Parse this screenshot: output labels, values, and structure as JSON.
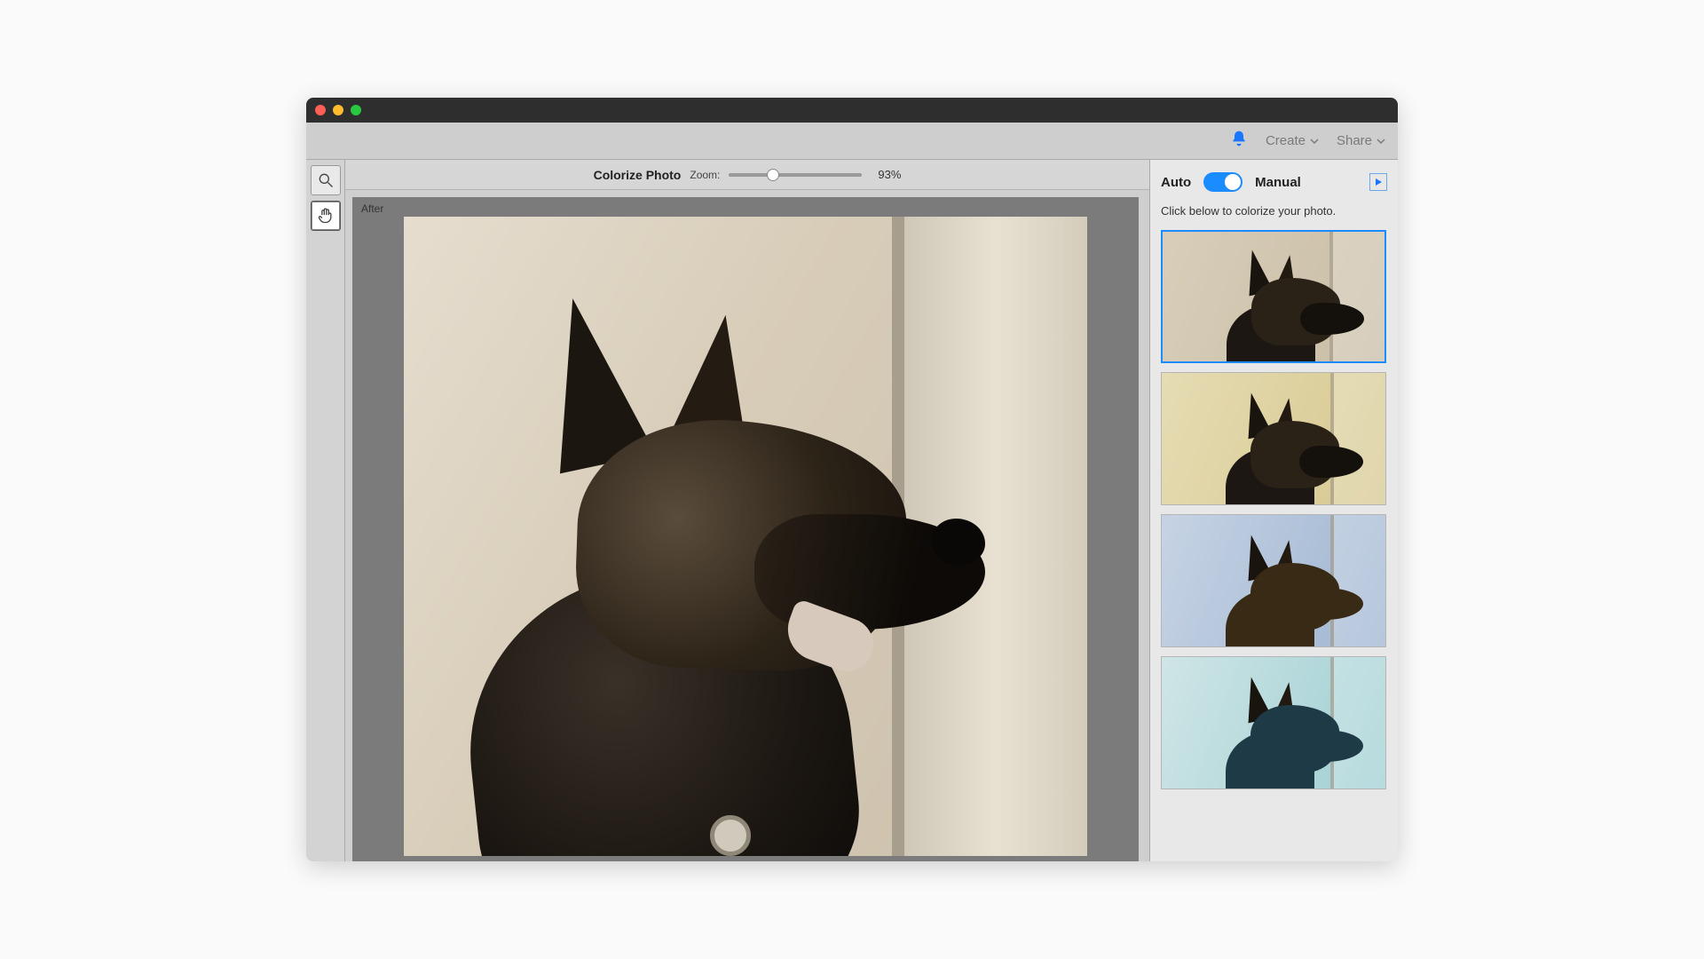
{
  "menubar": {
    "create": "Create",
    "share": "Share"
  },
  "tools": {
    "zoom": "zoom",
    "hand": "hand"
  },
  "header": {
    "title": "Colorize Photo",
    "zoom_label": "Zoom:",
    "zoom_value": "93%",
    "zoom_pct": 33
  },
  "canvas": {
    "after_label": "After"
  },
  "panel": {
    "auto": "Auto",
    "manual": "Manual",
    "hint": "Click below to colorize your photo.",
    "swatches": [
      "sepia",
      "warm",
      "cool",
      "teal"
    ],
    "selected_index": 0
  }
}
